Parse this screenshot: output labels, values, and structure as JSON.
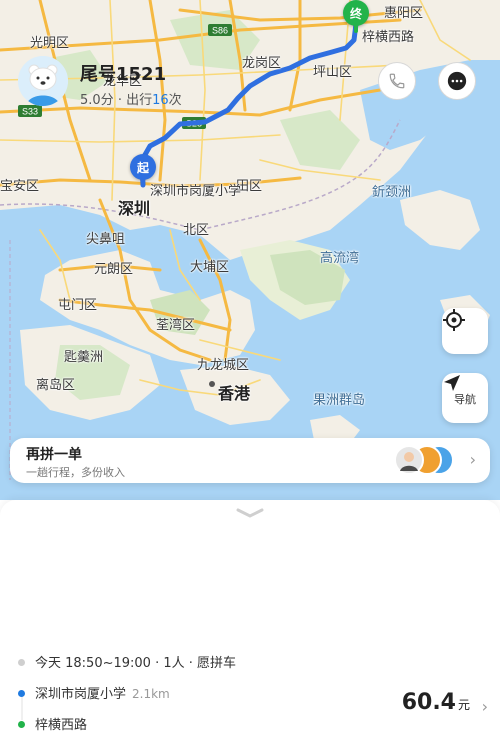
{
  "map": {
    "labels": {
      "huiyang": "惠阳区",
      "guangming": "光明区",
      "longgang": "龙岗区",
      "pingshan": "坪山区",
      "longhua": "龙华区",
      "baoan": "宝安区",
      "futian": "田区",
      "shenzhen": "深圳",
      "jianbizui": "尖鼻咀",
      "north": "北区",
      "yuenlong": "元朗区",
      "taipo": "大埔区",
      "tuenmun": "屯门区",
      "tsuenwan": "荃湾区",
      "kowloon": "九龙城区",
      "hongkong": "香港",
      "jichan": "匙羹洲",
      "islands": "离岛区",
      "guoquan": "果洲群岛",
      "gaoliuwan": "高流湾",
      "xinjingzhou": "釿颈洲",
      "road_s86": "S86",
      "road_s33": "S33",
      "road_s28": "S28"
    },
    "start_marker": "起",
    "end_marker": "终",
    "start_name": "深圳市岗厦小学",
    "end_name": "梓横西路",
    "route_color": "#2f6fe0",
    "water_color": "#a9d4f5",
    "land_color": "#f3efe6",
    "nav_label": "导航"
  },
  "pool": {
    "title": "再拼一单",
    "subtitle": "一趟行程，多份收入"
  },
  "driver": {
    "name": "尾号1521",
    "rating": "5.0分",
    "sep": "·",
    "trips_prefix": "出行",
    "trips_count": "16",
    "trips_suffix": "次"
  },
  "trip": {
    "summary": "今天 18:50~19:00 · 1人 · 愿拼车",
    "start": "深圳市岗厦小学",
    "start_distance": "2.1km",
    "end": "梓横西路",
    "price": "60.4",
    "price_unit": "元",
    "accent_blue": "#1f7ae0",
    "accent_green": "#22b34a"
  }
}
